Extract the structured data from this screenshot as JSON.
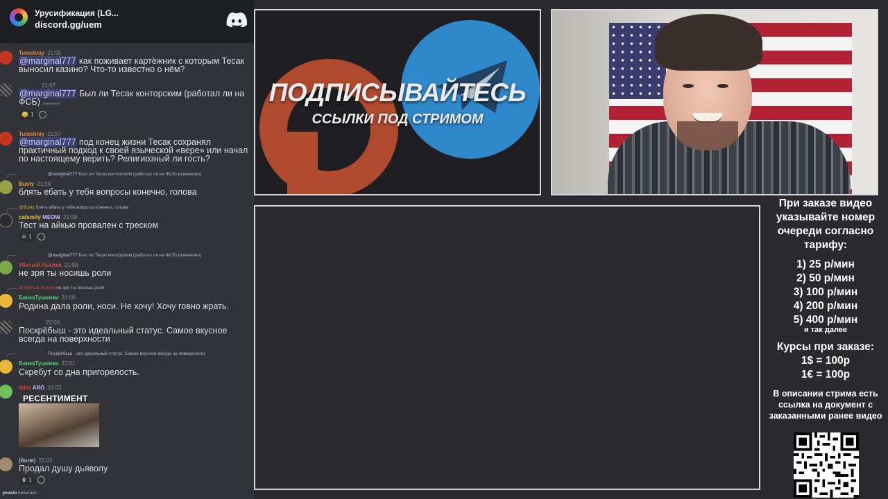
{
  "chat": {
    "server_name": "Урусификация (LG...",
    "server_link": "discord.gg/uem",
    "messages": [
      {
        "user": "Tuteshniy",
        "time": "21:55",
        "mention": "@marginal777",
        "text": "как поживает картёжник с которым Тесак выносил казино? Что-то известно о нём?"
      },
      {
        "user": "",
        "time": "21:57",
        "mention": "@marginal777",
        "text": "Был ли Тесак конторским (работал ли на ФСБ)",
        "edited": "(изменено)",
        "reaction_count": "1"
      },
      {
        "user": "Tuteshniy",
        "time": "21:57",
        "mention": "@marginal777",
        "text": "под конец жизни Тесак сохранял практичный подход к своей языческой «вере» или начал по настоящему верить? Религиозный ли гость?"
      },
      {
        "reply_user": "@marginal777",
        "reply_text": "Был ли Тесак конторским (работал ли на ФСБ)",
        "reply_edited": "(изменено)",
        "user": "Busty",
        "time": "21:59",
        "text": "блять ебать у тебя вопросы конечно, голова"
      },
      {
        "reply_user": "@Busty",
        "reply_text": "блять ебать у тебя вопросы конечно, голова",
        "user": "calamity",
        "tag": "MEOW",
        "time": "21:59",
        "text": "Тест на айкью провален с треском",
        "reaction_count": "1"
      },
      {
        "reply_user": "@marginal777",
        "reply_text": "Был ли Тесак конторским (работал ли на ФСБ)",
        "reply_edited": "(изменено)",
        "user": "Убитый Льолик",
        "time": "21:59",
        "text": "не зря ты носишь роли"
      },
      {
        "reply_user": "@Убитый Льолик",
        "reply_text": "не зря ты носишь роли",
        "user": "БанкаТушенки",
        "time": "22:00",
        "text": "Родина дала роли, носи. Не хочу! Хочу говно жрать."
      },
      {
        "user": "",
        "time": "22:00",
        "text": "Поскрёбыш - это идеальный статус. Самое вкусное всегда на поверхности"
      },
      {
        "reply_text": "Поскрёбыш - это идеальный статус. Самое вкусное всегда на поверхности",
        "user": "БанкаТушенки",
        "time": "22:01",
        "text": "Скребут со дна пригорелость."
      },
      {
        "user": "lhlirr",
        "tag": "ARG",
        "time": "22:03",
        "media_caption": "РЕСЕНТИМЕНТ"
      },
      {
        "user": "(йоле)",
        "time": "22:03",
        "text": "Продал душу дьяволу",
        "reaction_count": "1"
      }
    ],
    "typing_user": "prosto",
    "typing_text": "печатает..."
  },
  "banner": {
    "title": "ПОДПИСЫВАЙТЕСЬ",
    "subtitle": "ССЫЛКИ ПОД СТРИМОМ"
  },
  "info": {
    "title": "При заказе видео указывайте номер очереди согласно тарифу:",
    "prices": [
      "1) 25 р/мин",
      "2) 50 р/мин",
      "3) 100 р/мин",
      "4) 200 р/мин",
      "5) 400 р/мин"
    ],
    "etc": "и так далее",
    "rates_title": "Курсы при заказе:",
    "rate_usd": "1$ = 100р",
    "rate_eur": "1€ = 100р",
    "description_note": "В описании стрима есть ссылка на документ с заказанными ранее видео"
  },
  "colors": {
    "chat_bg": "#313338",
    "chat_header_bg": "#1e1f22",
    "mention": "#c9cdfb",
    "frame_border": "#d8d8d8",
    "telegram_blue": "#2f88c9",
    "patreon_red": "#b04a2f"
  }
}
